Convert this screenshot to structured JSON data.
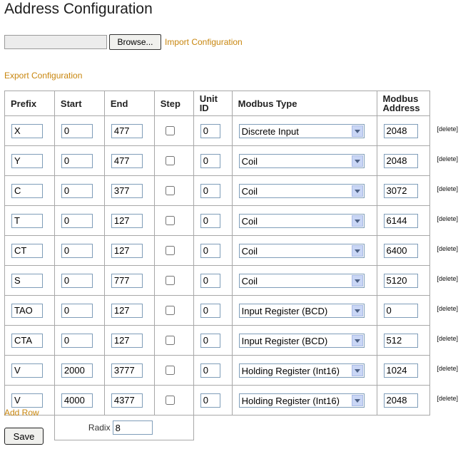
{
  "page": {
    "title": "Address Configuration",
    "import": {
      "browse_label": "Browse...",
      "link": "Import Configuration",
      "file_value": ""
    },
    "export_link": "Export Configuration",
    "add_row": "Add Row",
    "save_label": "Save"
  },
  "table": {
    "headers": {
      "prefix": "Prefix",
      "start": "Start",
      "end": "End",
      "step": "Step",
      "unit_id_1": "Unit",
      "unit_id_2": "ID",
      "modbus_type": "Modbus Type",
      "modbus_address_1": "Modbus",
      "modbus_address_2": "Address"
    },
    "delete_label": "[delete]",
    "rows": [
      {
        "prefix": "X",
        "start": "0",
        "end": "477",
        "step": false,
        "unit_id": "0",
        "type": "Discrete Input",
        "address": "2048"
      },
      {
        "prefix": "Y",
        "start": "0",
        "end": "477",
        "step": false,
        "unit_id": "0",
        "type": "Coil",
        "address": "2048"
      },
      {
        "prefix": "C",
        "start": "0",
        "end": "377",
        "step": false,
        "unit_id": "0",
        "type": "Coil",
        "address": "3072"
      },
      {
        "prefix": "T",
        "start": "0",
        "end": "127",
        "step": false,
        "unit_id": "0",
        "type": "Coil",
        "address": "6144"
      },
      {
        "prefix": "CT",
        "start": "0",
        "end": "127",
        "step": false,
        "unit_id": "0",
        "type": "Coil",
        "address": "6400"
      },
      {
        "prefix": "S",
        "start": "0",
        "end": "777",
        "step": false,
        "unit_id": "0",
        "type": "Coil",
        "address": "5120"
      },
      {
        "prefix": "TAO",
        "start": "0",
        "end": "127",
        "step": false,
        "unit_id": "0",
        "type": "Input Register (BCD)",
        "address": "0"
      },
      {
        "prefix": "CTA",
        "start": "0",
        "end": "127",
        "step": false,
        "unit_id": "0",
        "type": "Input Register (BCD)",
        "address": "512"
      },
      {
        "prefix": "V",
        "start": "2000",
        "end": "3777",
        "step": false,
        "unit_id": "0",
        "type": "Holding Register (Int16)",
        "address": "1024"
      },
      {
        "prefix": "V",
        "start": "4000",
        "end": "4377",
        "step": false,
        "unit_id": "0",
        "type": "Holding Register (Int16)",
        "address": "2048"
      }
    ],
    "radix": {
      "label": "Radix",
      "value": "8"
    }
  },
  "colors": {
    "link": "#c8860e",
    "border": "#a8a8a8",
    "input_border": "#7f9db9",
    "dropdown_button": "#c9d6f5"
  }
}
